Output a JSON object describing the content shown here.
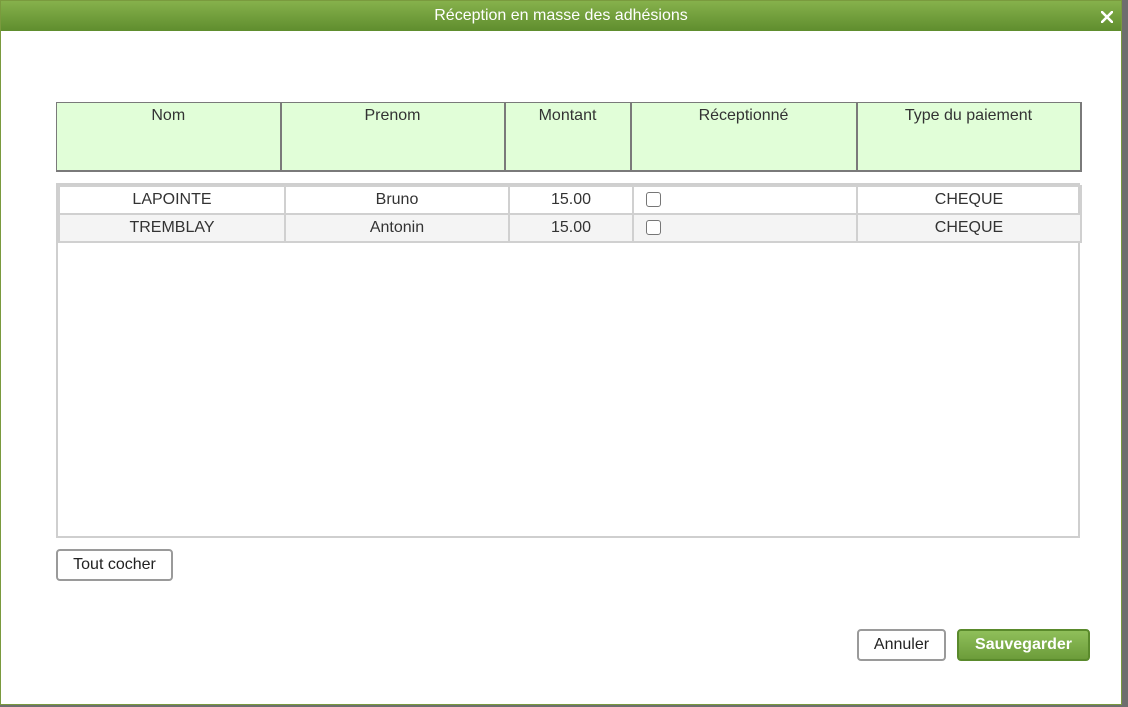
{
  "dialog": {
    "title": "Réception en masse des adhésions",
    "close_icon": "close-icon"
  },
  "table": {
    "headers": [
      "Nom",
      "Prenom",
      "Montant",
      "Réceptionné",
      "Type du paiement"
    ],
    "rows": [
      {
        "nom": "LAPOINTE",
        "prenom": "Bruno",
        "montant": "15.00",
        "receptionne": false,
        "type": "CHEQUE"
      },
      {
        "nom": "TREMBLAY",
        "prenom": "Antonin",
        "montant": "15.00",
        "receptionne": false,
        "type": "CHEQUE"
      }
    ]
  },
  "buttons": {
    "check_all": "Tout cocher",
    "cancel": "Annuler",
    "save": "Sauvegarder"
  },
  "colors": {
    "title_bar": "#6f9e3a",
    "header_bg": "#e1fed8",
    "save_button": "#7aad45"
  }
}
